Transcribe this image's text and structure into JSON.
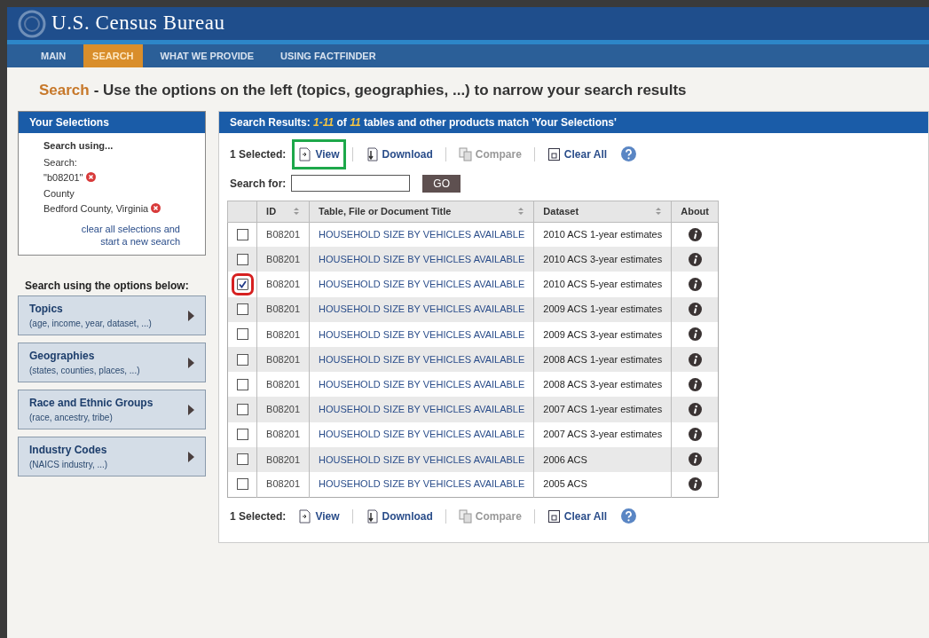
{
  "header": {
    "title": "U.S. Census Bureau"
  },
  "nav": [
    {
      "label": "MAIN",
      "selected": false
    },
    {
      "label": "SEARCH",
      "selected": true
    },
    {
      "label": "WHAT WE PROVIDE",
      "selected": false
    },
    {
      "label": "USING FACTFINDER",
      "selected": false
    }
  ],
  "heading": {
    "label": "Search",
    "text": "- Use the options on the left (topics, geographies, ...) to narrow your search results"
  },
  "selections": {
    "title": "Your Selections",
    "intro": "Search using...",
    "items": [
      {
        "label": "Search:",
        "value": "\"b08201\""
      },
      {
        "label": "County",
        "value": "Bedford County, Virginia"
      }
    ],
    "clear_link": "clear all selections and start a new search"
  },
  "options": {
    "title": "Search using the options below:",
    "items": [
      {
        "label": "Topics",
        "hint": "(age, income, year, dataset, ...)"
      },
      {
        "label": "Geographies",
        "hint": "(states, counties, places, ...)"
      },
      {
        "label": "Race and Ethnic Groups",
        "hint": "(race, ancestry, tribe)"
      },
      {
        "label": "Industry Codes",
        "hint": "(NAICS industry, ...)"
      }
    ]
  },
  "results": {
    "title": "Search Results: *1-11* of *11* tables and other products match 'Your Selections'",
    "toolbar_top": {
      "count": "1 Selected:",
      "actions": [
        {
          "kind": "view",
          "label": "View",
          "disabled": false,
          "highlighted": true
        },
        {
          "kind": "download",
          "label": "Download",
          "disabled": false,
          "highlighted": false
        },
        {
          "kind": "compare",
          "label": "Compare",
          "disabled": true,
          "highlighted": false
        },
        {
          "kind": "clear",
          "label": "Clear All",
          "disabled": false,
          "highlighted": false
        }
      ]
    },
    "search": {
      "label": "Search for:",
      "button": "GO"
    },
    "columns": [
      "ID",
      "Table, File or Document Title",
      "Dataset",
      "About"
    ],
    "rows": [
      {
        "checked": false,
        "circled": false,
        "id": "B08201",
        "title": "HOUSEHOLD SIZE BY VEHICLES AVAILABLE",
        "dataset": "2010 ACS 1-year estimates"
      },
      {
        "checked": false,
        "circled": false,
        "id": "B08201",
        "title": "HOUSEHOLD SIZE BY VEHICLES AVAILABLE",
        "dataset": "2010 ACS 3-year estimates"
      },
      {
        "checked": true,
        "circled": true,
        "id": "B08201",
        "title": "HOUSEHOLD SIZE BY VEHICLES AVAILABLE",
        "dataset": "2010 ACS 5-year estimates"
      },
      {
        "checked": false,
        "circled": false,
        "id": "B08201",
        "title": "HOUSEHOLD SIZE BY VEHICLES AVAILABLE",
        "dataset": "2009 ACS 1-year estimates"
      },
      {
        "checked": false,
        "circled": false,
        "id": "B08201",
        "title": "HOUSEHOLD SIZE BY VEHICLES AVAILABLE",
        "dataset": "2009 ACS 3-year estimates"
      },
      {
        "checked": false,
        "circled": false,
        "id": "B08201",
        "title": "HOUSEHOLD SIZE BY VEHICLES AVAILABLE",
        "dataset": "2008 ACS 1-year estimates"
      },
      {
        "checked": false,
        "circled": false,
        "id": "B08201",
        "title": "HOUSEHOLD SIZE BY VEHICLES AVAILABLE",
        "dataset": "2008 ACS 3-year estimates"
      },
      {
        "checked": false,
        "circled": false,
        "id": "B08201",
        "title": "HOUSEHOLD SIZE BY VEHICLES AVAILABLE",
        "dataset": "2007 ACS 1-year estimates"
      },
      {
        "checked": false,
        "circled": false,
        "id": "B08201",
        "title": "HOUSEHOLD SIZE BY VEHICLES AVAILABLE",
        "dataset": "2007 ACS 3-year estimates"
      },
      {
        "checked": false,
        "circled": false,
        "id": "B08201",
        "title": "HOUSEHOLD SIZE BY VEHICLES AVAILABLE",
        "dataset": "2006 ACS"
      },
      {
        "checked": false,
        "circled": false,
        "id": "B08201",
        "title": "HOUSEHOLD SIZE BY VEHICLES AVAILABLE",
        "dataset": "2005 ACS"
      }
    ],
    "toolbar_bottom": {
      "count": "1 Selected:",
      "actions": [
        {
          "kind": "view",
          "label": "View",
          "disabled": false,
          "highlighted": false
        },
        {
          "kind": "download",
          "label": "Download",
          "disabled": false,
          "highlighted": false
        },
        {
          "kind": "compare",
          "label": "Compare",
          "disabled": true,
          "highlighted": false
        },
        {
          "kind": "clear",
          "label": "Clear All",
          "disabled": false,
          "highlighted": false
        }
      ]
    }
  }
}
